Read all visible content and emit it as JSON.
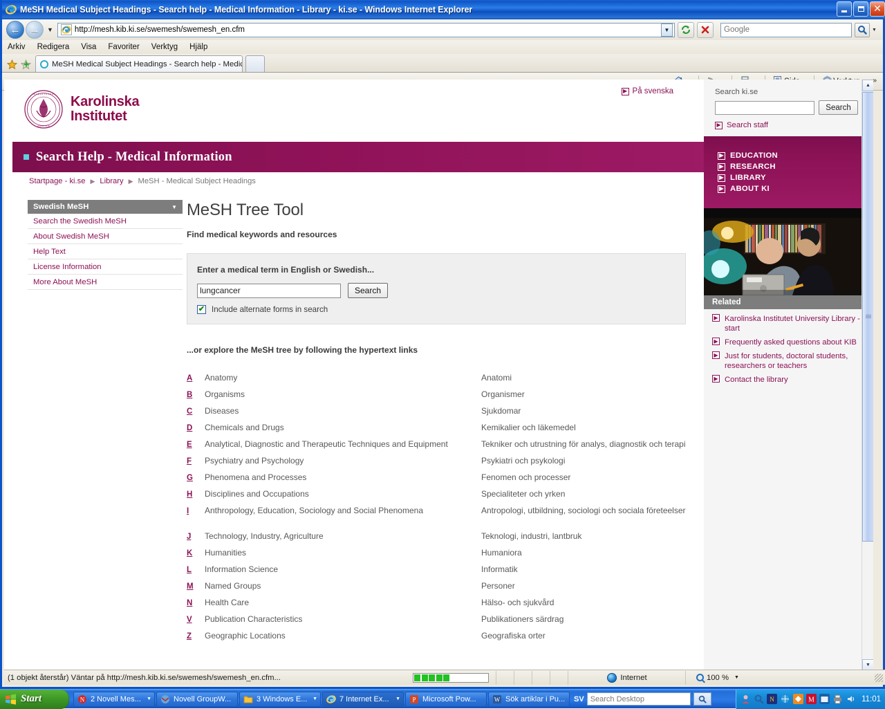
{
  "window": {
    "title": "MeSH Medical Subject Headings - Search help - Medical Information - Library - ki.se - Windows Internet Explorer",
    "minimize_label": "Minimize",
    "maximize_label": "Maximize",
    "close_label": "Close"
  },
  "browser": {
    "url": "http://mesh.kib.ki.se/swemesh/swemesh_en.cfm",
    "search_placeholder": "Google",
    "menu": [
      "Arkiv",
      "Redigera",
      "Visa",
      "Favoriter",
      "Verktyg",
      "Hjälp"
    ],
    "tab_title": "MeSH Medical Subject Headings - Search help - Medic...",
    "commands": [
      {
        "label": "",
        "icon": "home-icon"
      },
      {
        "label": "",
        "icon": "feeds-icon"
      },
      {
        "label": "",
        "icon": "print-icon"
      },
      {
        "label": "Sida",
        "icon": "page-icon"
      },
      {
        "label": "Verktyg",
        "icon": "tools-gear-icon"
      }
    ],
    "overflow_label": "»"
  },
  "site": {
    "logo_line1": "Karolinska",
    "logo_line2": "Institutet",
    "seal_text": "KAROLINSKA INSTITUTET · ANNO 1810 ·",
    "language_link": "På svenska",
    "section_title": "Search Help - Medical Information",
    "breadcrumb": [
      "Startpage - ki.se",
      "Library",
      "MeSH - Medical Subject Headings"
    ]
  },
  "left_nav": {
    "header": "Swedish MeSH",
    "items": [
      "Search the Swedish MeSH",
      "About Swedish MeSH",
      "Help Text",
      "License Information",
      "More About MeSH"
    ]
  },
  "main": {
    "page_title": "MeSH Tree Tool",
    "subtitle": "Find medical keywords and resources",
    "panel_label": "Enter a medical term in English or Swedish...",
    "search_value": "lungcancer",
    "search_button": "Search",
    "checkbox_label": "Include alternate forms in search",
    "checkbox_checked": true,
    "explore_line": "...or explore the MeSH tree by following the hypertext links",
    "tree": [
      {
        "letter": "A",
        "en": "Anatomy",
        "sv": "Anatomi"
      },
      {
        "letter": "B",
        "en": "Organisms",
        "sv": "Organismer"
      },
      {
        "letter": "C",
        "en": "Diseases",
        "sv": "Sjukdomar"
      },
      {
        "letter": "D",
        "en": "Chemicals and Drugs",
        "sv": "Kemikalier och läkemedel"
      },
      {
        "letter": "E",
        "en": "Analytical, Diagnostic and Therapeutic Techniques and Equipment",
        "sv": "Tekniker och utrustning för analys, diagnostik och terapi"
      },
      {
        "letter": "F",
        "en": "Psychiatry and Psychology",
        "sv": "Psykiatri och psykologi"
      },
      {
        "letter": "G",
        "en": "Phenomena and Processes",
        "sv": "Fenomen och processer"
      },
      {
        "letter": "H",
        "en": "Disciplines and Occupations",
        "sv": "Specialiteter och yrken"
      },
      {
        "letter": "I",
        "en": "Anthropology, Education, Sociology and Social Phenomena",
        "sv": "Antropologi, utbildning, sociologi och sociala företeelser"
      },
      {
        "letter": "J",
        "en": "Technology, Industry, Agriculture",
        "sv": "Teknologi, industri, lantbruk"
      },
      {
        "letter": "K",
        "en": "Humanities",
        "sv": "Humaniora"
      },
      {
        "letter": "L",
        "en": "Information Science",
        "sv": "Informatik"
      },
      {
        "letter": "M",
        "en": "Named Groups",
        "sv": "Personer"
      },
      {
        "letter": "N",
        "en": "Health Care",
        "sv": "Hälso- och sjukvård"
      },
      {
        "letter": "V",
        "en": "Publication Characteristics",
        "sv": "Publikationers särdrag"
      },
      {
        "letter": "Z",
        "en": "Geographic Locations",
        "sv": "Geografiska orter"
      }
    ]
  },
  "right_col": {
    "search_label": "Search ki.se",
    "search_value": "",
    "search_button": "Search",
    "staff_link": "Search staff",
    "nav": [
      "EDUCATION",
      "RESEARCH",
      "LIBRARY",
      "ABOUT KI"
    ],
    "related_header": "Related",
    "related": [
      "Karolinska Institutet University Library - start",
      "Frequently asked questions about KIB",
      "Just for students, doctoral students, researchers or teachers",
      "Contact the library"
    ]
  },
  "statusbar": {
    "text": "(1 objekt återstår) Väntar på http://mesh.kib.ki.se/swemesh/swemesh_en.cfm...",
    "zone": "Internet",
    "zoom": "100 %",
    "progress_segments": 5
  },
  "taskbar": {
    "start_label": "Start",
    "tasks": [
      {
        "label": "2 Novell Mes...",
        "icon": "novell-messenger-icon"
      },
      {
        "label": "Novell GroupW...",
        "icon": "novell-groupwise-icon"
      },
      {
        "label": "3 Windows E...",
        "icon": "folder-icon"
      },
      {
        "label": "7 Internet Ex...",
        "icon": "ie-icon"
      },
      {
        "label": "Microsoft Pow...",
        "icon": "powerpoint-icon"
      },
      {
        "label": "Sök artiklar i Pu...",
        "icon": "word-icon"
      }
    ],
    "language": "SV",
    "desktop_search_placeholder": "Search Desktop",
    "clock": "11:01"
  },
  "colors": {
    "ki_magenta": "#8b1256",
    "band_dark": "#7d0f4e",
    "grey_header": "#7d7d7d",
    "panel_bg": "#efefef",
    "accent_cyan": "#5ecfe0"
  }
}
